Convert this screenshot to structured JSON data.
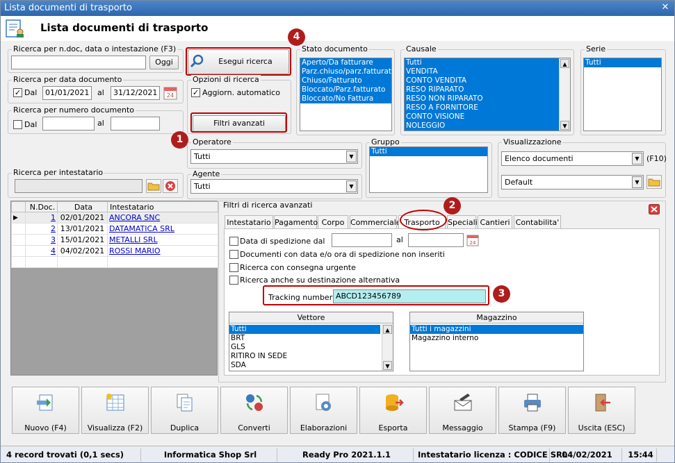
{
  "window": {
    "title": "Lista documenti di trasporto",
    "close_label": "✕"
  },
  "header": {
    "title": "Lista documenti di trasporto"
  },
  "search_ndoc": {
    "legend": "Ricerca per n.doc, data o intestazione (F3)",
    "value": "",
    "button": "Oggi"
  },
  "search_date": {
    "legend": "Ricerca per data documento",
    "dal_label": "Dal",
    "dal_checked": true,
    "from": "01/01/2021",
    "al_label": "al",
    "to": "31/12/2021"
  },
  "search_number": {
    "legend": "Ricerca per numero documento",
    "dal_label": "Dal",
    "dal_checked": false,
    "from": "",
    "al_label": "al",
    "to": ""
  },
  "search_holder": {
    "legend": "Ricerca per intestatario",
    "value": ""
  },
  "esegui": {
    "label": "Esegui ricerca"
  },
  "options": {
    "legend": "Opzioni di ricerca",
    "auto_label": "Aggiorn. automatico",
    "auto_checked": true
  },
  "filtri_btn": {
    "label": "Filtri avanzati"
  },
  "stato": {
    "legend": "Stato documento",
    "items": [
      "Aperto/Da fatturare",
      "Parz.chiuso/parz.fatturato",
      "Chiuso/Fatturato",
      "Bloccato/Parz.fatturato",
      "Bloccato/No Fattura"
    ]
  },
  "causale": {
    "legend": "Causale",
    "items": [
      "Tutti",
      "VENDITA",
      "CONTO VENDITA",
      "RESO RIPARATO",
      "RESO NON RIPARATO",
      "RESO A FORNITORE",
      "CONTO VISIONE",
      "NOLEGGIO"
    ]
  },
  "serie": {
    "legend": "Serie",
    "items": [
      "Tutti"
    ]
  },
  "operatore": {
    "legend": "Operatore",
    "value": "Tutti"
  },
  "agente": {
    "legend": "Agente",
    "value": "Tutti"
  },
  "gruppo": {
    "legend": "Gruppo",
    "items": [
      "Tutti"
    ]
  },
  "visualizzazione": {
    "legend": "Visualizzazione",
    "value": "Elenco documenti",
    "shortcut": "(F10)",
    "second_value": "Default"
  },
  "grid": {
    "columns": [
      "N.Doc.",
      "Data",
      "Intestatario"
    ],
    "rows": [
      {
        "ndoc": "1",
        "data": "02/01/2021",
        "intestatario": "ANCORA SNC"
      },
      {
        "ndoc": "2",
        "data": "13/01/2021",
        "intestatario": "DATAMATICA SRL"
      },
      {
        "ndoc": "3",
        "data": "15/01/2021",
        "intestatario": "METALLI SRL"
      },
      {
        "ndoc": "4",
        "data": "04/02/2021",
        "intestatario": "ROSSI MARIO"
      }
    ]
  },
  "advanced": {
    "legend": "Filtri di ricerca avanzati",
    "tabs": [
      "Intestatario",
      "Pagamento",
      "Corpo",
      "Commerciale",
      "Trasporto",
      "Speciali",
      "Cantieri",
      "Contabilita'"
    ],
    "active_tab": "Trasporto",
    "spedizione_label": "Data di spedizione dal",
    "spedizione_al": "al",
    "opt_no_spedizione": "Documenti con data e/o ora di spedizione non inseriti",
    "opt_urgente": "Ricerca con consegna urgente",
    "opt_dest": "Ricerca anche su destinazione alternativa",
    "tracking_label": "Tracking number :",
    "tracking_value": "ABCD123456789",
    "vettore": {
      "header": "Vettore",
      "items": [
        "Tutti",
        "BRT",
        "GLS",
        "RITIRO IN SEDE",
        "SDA"
      ]
    },
    "magazzino": {
      "header": "Magazzino",
      "items": [
        "Tutti i magazzini",
        "Magazzino interno"
      ]
    }
  },
  "callouts": [
    "1",
    "2",
    "3",
    "4"
  ],
  "toolbar": [
    {
      "label": "Nuovo (F4)",
      "icon": "new-doc-icon"
    },
    {
      "label": "Visualizza (F2)",
      "icon": "view-grid-icon"
    },
    {
      "label": "Duplica",
      "icon": "copy-icon"
    },
    {
      "label": "Converti",
      "icon": "convert-icon"
    },
    {
      "label": "Elaborazioni",
      "icon": "process-icon"
    },
    {
      "label": "Esporta",
      "icon": "export-icon"
    },
    {
      "label": "Messaggio",
      "icon": "message-icon"
    },
    {
      "label": "Stampa (F9)",
      "icon": "print-icon"
    },
    {
      "label": "Uscita (ESC)",
      "icon": "exit-icon"
    }
  ],
  "status": {
    "records": "4 record trovati (0,1 secs)",
    "company": "Informatica Shop Srl",
    "version": "Ready Pro 2021.1.1",
    "license": "Intestatario licenza : CODICE SRL",
    "date": "04/02/2021",
    "time": "15:44"
  },
  "colors": {
    "accent": "#0078d7",
    "callout": "#b01c1c",
    "highlight": "#c00000",
    "tracking_bg": "#b4eef0"
  }
}
